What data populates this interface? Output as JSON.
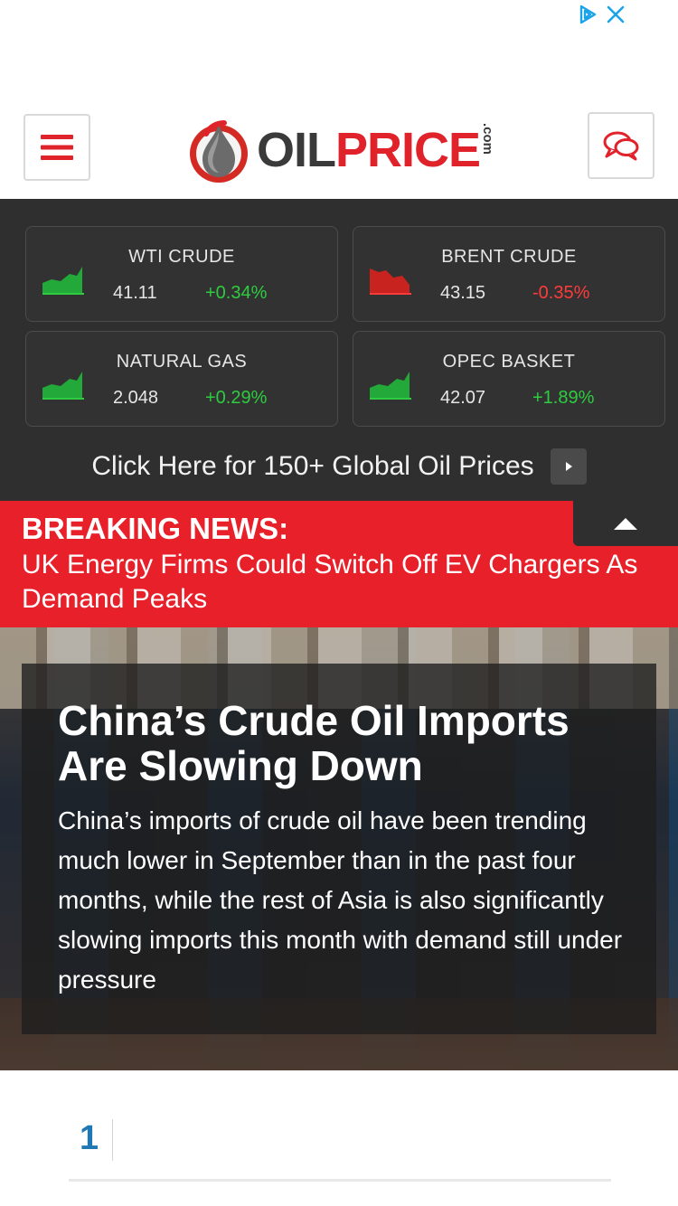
{
  "ad": {
    "adchoices_icon": "adchoices-icon",
    "close_icon": "close-icon"
  },
  "header": {
    "menu_icon": "hamburger-menu-icon",
    "logo_oil": "OIL",
    "logo_price": "PRICE",
    "logo_com": ".com",
    "chat_icon": "chat-bubbles-icon",
    "brand_color": "#e0232b"
  },
  "prices": {
    "items": [
      {
        "name": "WTI CRUDE",
        "value": "41.11",
        "change": "+0.34%",
        "trend": "up"
      },
      {
        "name": "BRENT CRUDE",
        "value": "43.15",
        "change": "-0.35%",
        "trend": "down"
      },
      {
        "name": "NATURAL GAS",
        "value": "2.048",
        "change": "+0.29%",
        "trend": "up"
      },
      {
        "name": "OPEC BASKET",
        "value": "42.07",
        "change": "+1.89%",
        "trend": "up"
      }
    ],
    "global_link": "Click Here for 150+ Global Oil Prices",
    "up_color": "#2ecc40",
    "down_color": "#ff3b3b"
  },
  "breaking": {
    "title": "BREAKING NEWS:",
    "text": "UK Energy Firms Could Switch Off EV Chargers As Demand Peaks",
    "color": "#e8202a"
  },
  "hero": {
    "title": "China’s Crude Oil Imports Are Slowing Down",
    "description": "China’s imports of crude oil have been trending much lower in September than in the past four months, while the rest of Asia is also significantly slowing imports this month with demand still under pressure"
  },
  "list": {
    "first_number": "1"
  }
}
